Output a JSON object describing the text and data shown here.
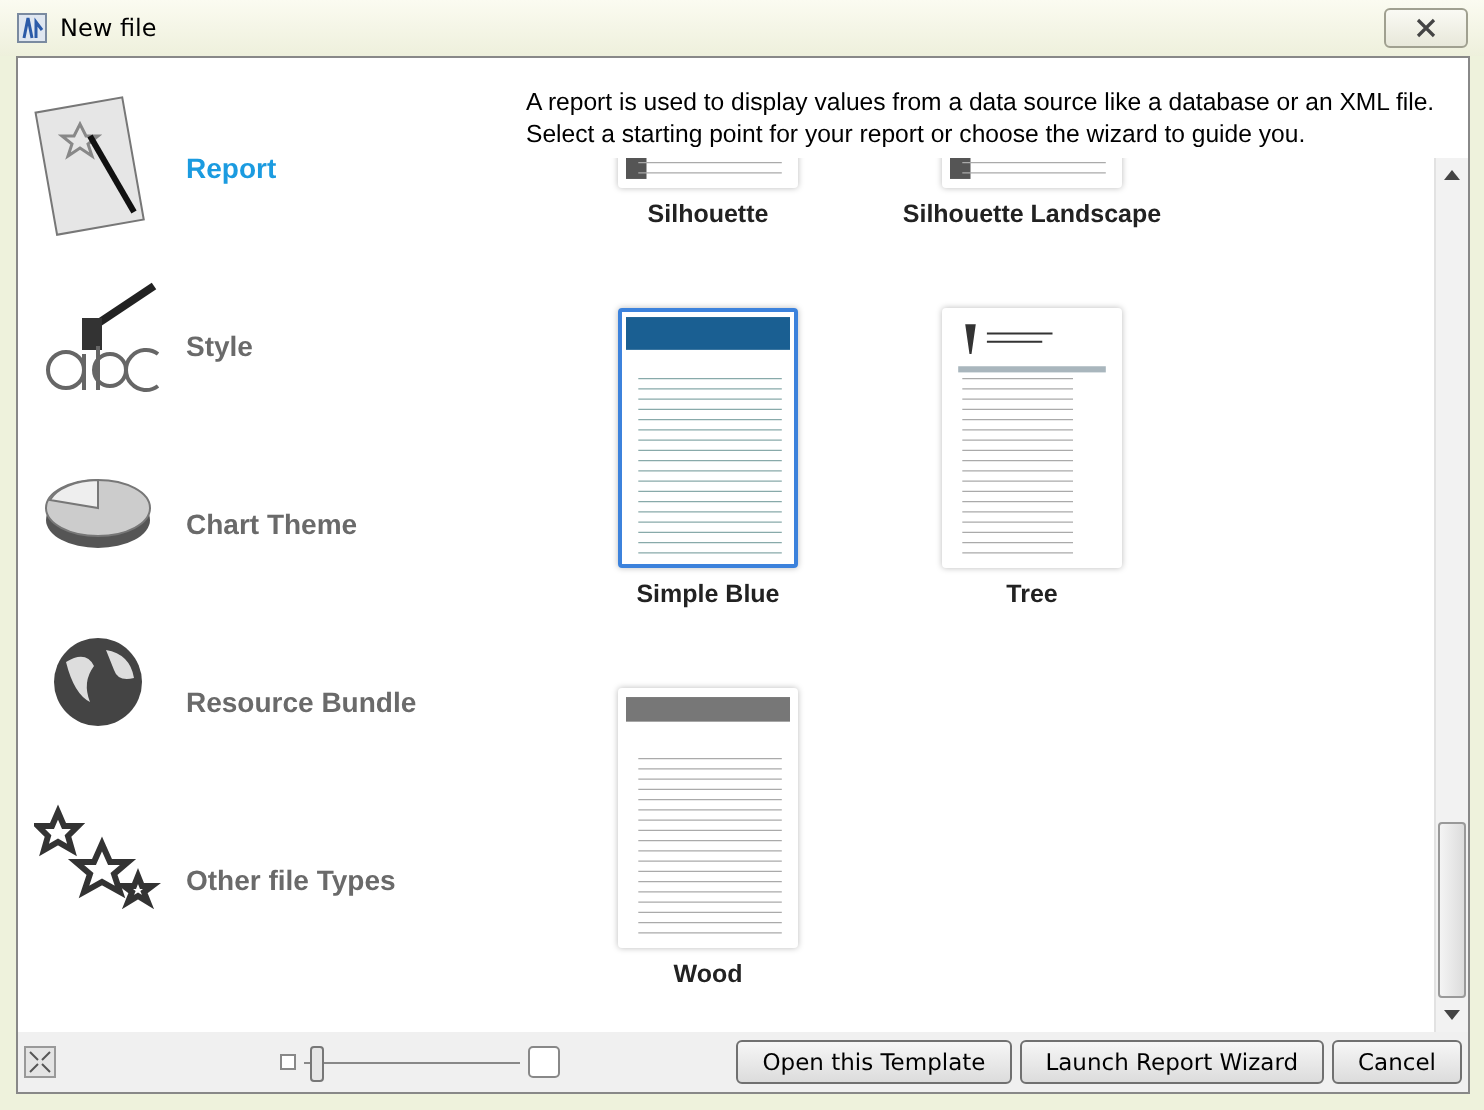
{
  "window": {
    "title": "New file"
  },
  "sidebar": {
    "items": [
      {
        "label": "Report",
        "kind": "report",
        "selected": true
      },
      {
        "label": "Style",
        "kind": "style",
        "selected": false
      },
      {
        "label": "Chart Theme",
        "kind": "chart",
        "selected": false
      },
      {
        "label": "Resource Bundle",
        "kind": "globe",
        "selected": false
      },
      {
        "label": "Other file Types",
        "kind": "stars",
        "selected": false
      }
    ]
  },
  "description": "A report is used to display values from a data source like a database or an XML file. Select a starting point for your report or choose the wizard to guide you.",
  "templates": [
    {
      "label": "Silhouette",
      "kind": "silhouette",
      "selected": false
    },
    {
      "label": "Silhouette Landscape",
      "kind": "landscape",
      "selected": false
    },
    {
      "label": "Simple Blue",
      "kind": "blue",
      "selected": true
    },
    {
      "label": "Tree",
      "kind": "tree",
      "selected": false
    },
    {
      "label": "Wood",
      "kind": "wood",
      "selected": false
    }
  ],
  "zoom_slider": {
    "level": 0.03
  },
  "buttons": [
    "Open this Template",
    "Launch Report Wizard",
    "Cancel"
  ]
}
